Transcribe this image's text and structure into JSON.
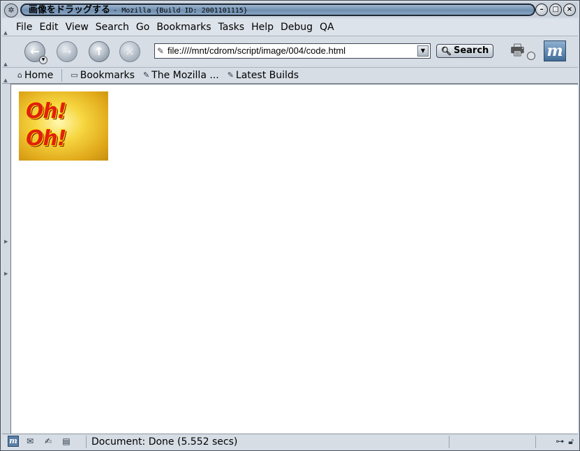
{
  "window": {
    "title_jp": "画像をドラッグする",
    "title_rest": "- Mozilla {Build ID: 2001101115}"
  },
  "menubar": {
    "items": [
      "File",
      "Edit",
      "View",
      "Search",
      "Go",
      "Bookmarks",
      "Tasks",
      "Help",
      "Debug",
      "QA"
    ]
  },
  "navbar": {
    "url": "file:////mnt/cdrom/script/image/004/code.html",
    "search_label": "Search"
  },
  "personal_toolbar": {
    "home": "Home",
    "bookmarks": "Bookmarks",
    "mozilla": "The Mozilla ...",
    "latest": "Latest Builds"
  },
  "content": {
    "image_text_1": "Oh!",
    "image_text_2": "Oh!"
  },
  "status": {
    "text": "Document: Done (5.552 secs)"
  },
  "icons": {
    "moz_letter": "m"
  }
}
